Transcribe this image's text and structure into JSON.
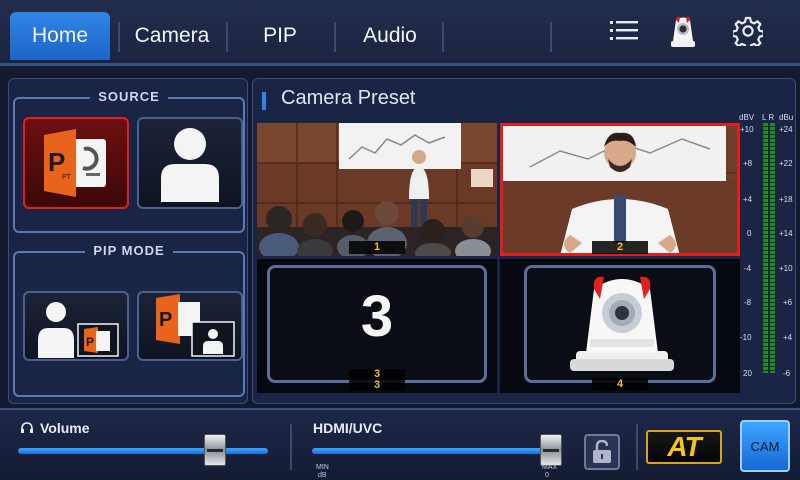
{
  "nav": {
    "tabs": [
      {
        "label": "Home",
        "active": true
      },
      {
        "label": "Camera",
        "active": false
      },
      {
        "label": "PIP",
        "active": false
      },
      {
        "label": "Audio",
        "active": false
      }
    ],
    "icons": [
      "list-icon",
      "ptz-camera-icon",
      "gear-icon"
    ]
  },
  "source": {
    "title": "SOURCE",
    "items": [
      {
        "name": "ppt-source",
        "selected": true
      },
      {
        "name": "person-source",
        "selected": false
      }
    ]
  },
  "pip_mode": {
    "title": "PIP MODE",
    "items": [
      {
        "name": "person-with-ppt-inset"
      },
      {
        "name": "ppt-with-person-inset"
      }
    ]
  },
  "camera_preset": {
    "title": "Camera Preset",
    "presets": [
      {
        "label": "1",
        "active": false
      },
      {
        "label": "2",
        "active": true
      },
      {
        "label": "3",
        "center_label": "3",
        "active": false
      },
      {
        "label": "4",
        "active": false
      }
    ]
  },
  "vu_meter": {
    "left_header": "dBV",
    "channel_header": "L R",
    "right_header": "dBu",
    "dbv_scale": [
      "+10",
      "+8",
      "+4",
      "0",
      "-4",
      "-8",
      "-10",
      "20"
    ],
    "dbu_scale": [
      "+24",
      "+22",
      "+18",
      "+14",
      "+10",
      "+6",
      "+4",
      "-6"
    ]
  },
  "bottom": {
    "volume_label": "Volume",
    "volume_level": 0.83,
    "hdmi_label": "HDMI/UVC",
    "hdmi_level": 1.0,
    "min_label": "MIN",
    "max_label": "MAX",
    "db_label": "dB",
    "zero_label": "0",
    "at_label": "AT",
    "cam_label": "CAM"
  },
  "colors": {
    "accent": "#2f86e6",
    "active_border": "#e01e1e",
    "preset_label": "#f0c020",
    "at_text": "#f5c518"
  }
}
